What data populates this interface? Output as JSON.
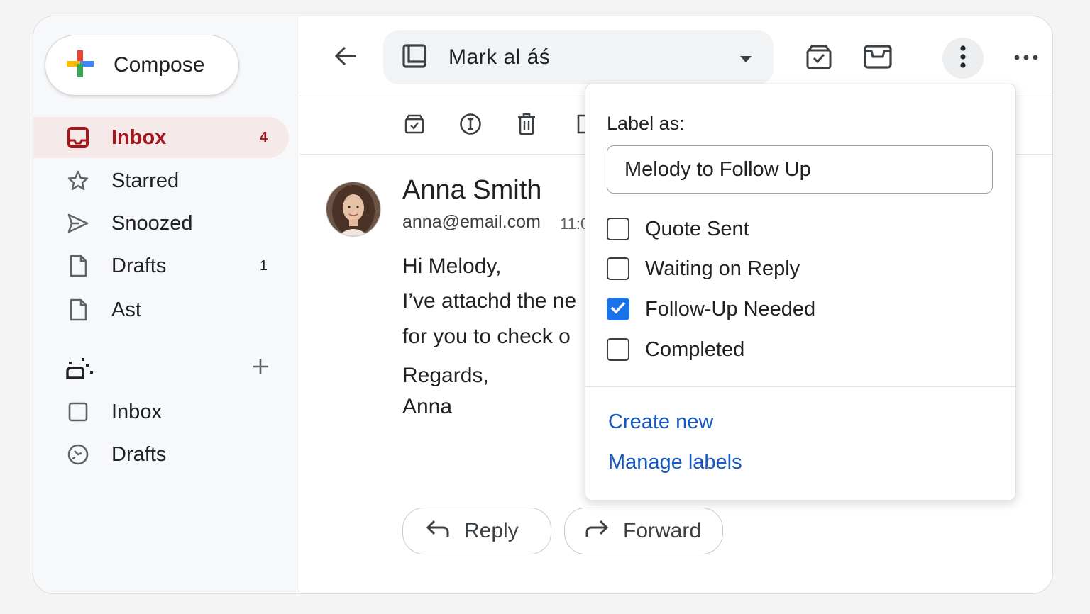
{
  "sidebar": {
    "compose_label": "Compose",
    "items": [
      {
        "label": "Inbox",
        "count": "4",
        "icon": "inbox-icon",
        "active": true
      },
      {
        "label": "Starred",
        "count": "",
        "icon": "star-icon"
      },
      {
        "label": "Snoozed",
        "count": "",
        "icon": "send-icon"
      },
      {
        "label": "Drafts",
        "count": "1",
        "icon": "draft-icon"
      },
      {
        "label": "Ast",
        "count": "",
        "icon": "document-icon"
      }
    ],
    "labels_section": [
      {
        "label": "Inbox",
        "icon": "square-icon"
      },
      {
        "label": "Drafts",
        "icon": "clock-icon"
      }
    ]
  },
  "toolbar": {
    "mark_as_label": "Mark al áś"
  },
  "message": {
    "sender_name": "Anna Smith",
    "sender_email": "anna@email.com",
    "time": "11:0",
    "body_lines": [
      "Hi Melody,",
      "I’ve attachd  the ne",
      "for you to check o",
      "Regards,",
      "Anna"
    ],
    "reply_label": "Reply",
    "forward_label": "Forward"
  },
  "label_popup": {
    "title": "Label as:",
    "search_value": "Melody to Follow Up",
    "options": [
      {
        "label": "Quote Sent",
        "checked": false
      },
      {
        "label": "Waiting on Reply",
        "checked": false
      },
      {
        "label": "Follow-Up Needed",
        "checked": true
      },
      {
        "label": "Completed",
        "checked": false
      }
    ],
    "create_new": "Create new",
    "manage_labels": "Manage labels"
  },
  "colors": {
    "accent_red": "#a5161b",
    "active_bg": "#f5e9e9",
    "link_blue": "#1558c0",
    "checkbox_blue": "#1a73e8"
  }
}
